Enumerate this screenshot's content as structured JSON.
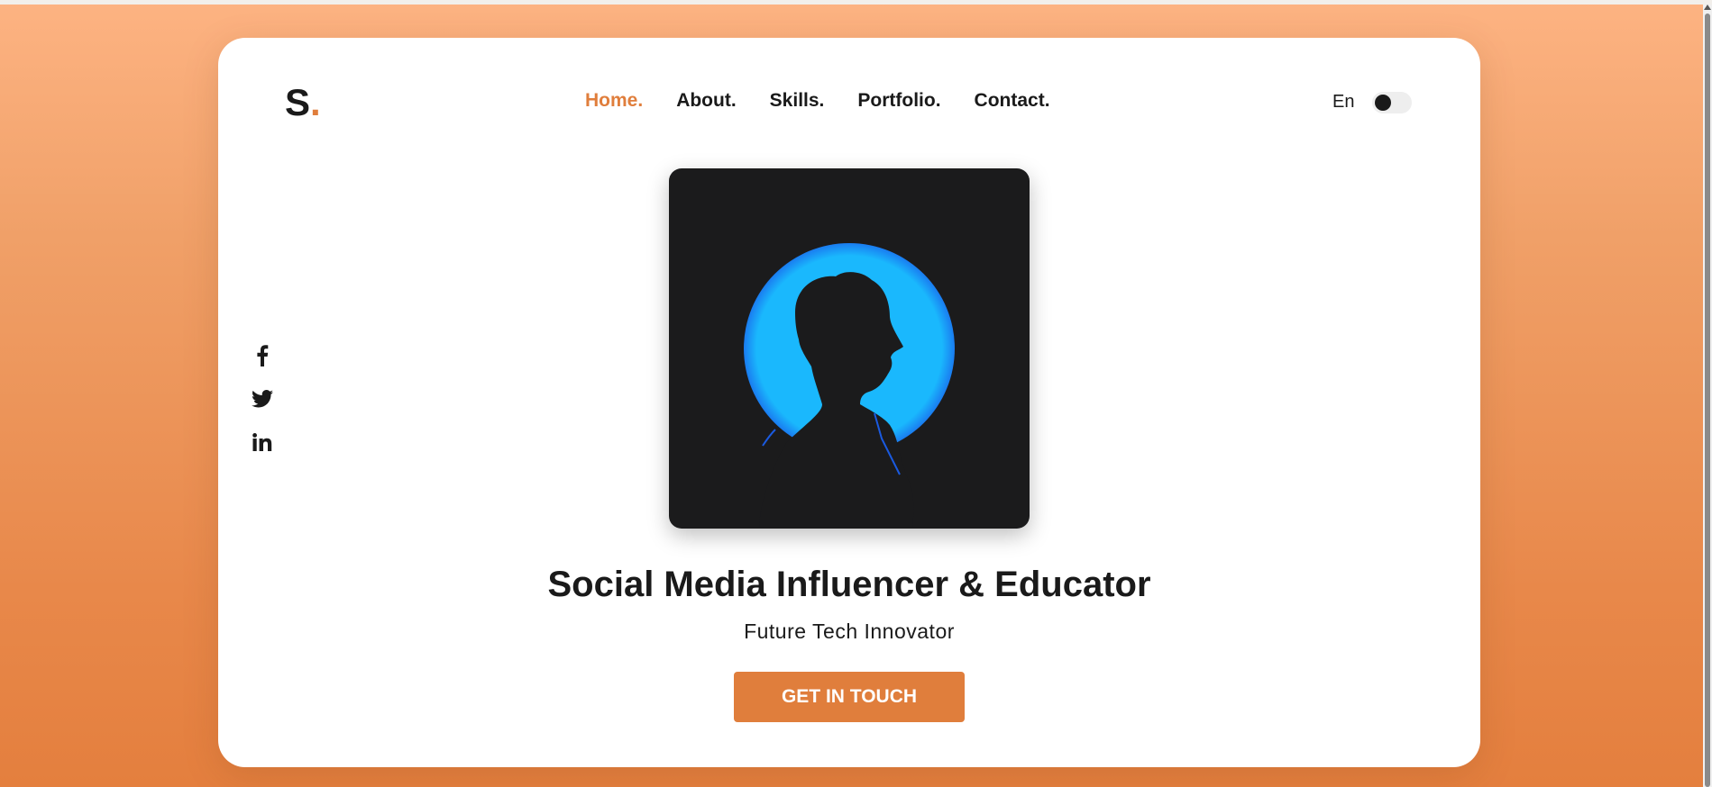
{
  "logo": {
    "letter": "S",
    "dot": "."
  },
  "nav": {
    "items": [
      {
        "label": "Home.",
        "active": true
      },
      {
        "label": "About.",
        "active": false
      },
      {
        "label": "Skills.",
        "active": false
      },
      {
        "label": "Portfolio.",
        "active": false
      },
      {
        "label": "Contact.",
        "active": false
      }
    ]
  },
  "language": {
    "label": "En"
  },
  "theme_toggle": {
    "state": "off"
  },
  "social": [
    "facebook-icon",
    "twitter-icon",
    "linkedin-icon"
  ],
  "hero": {
    "headline": "Social Media Influencer & Educator",
    "subtitle": "Future Tech Innovator",
    "cta_label": "GET IN TOUCH"
  },
  "colors": {
    "accent": "#e07e3c",
    "text": "#1a1a1a",
    "photo_bg": "#1b1b1c",
    "photo_circle": "#1ab8fd"
  }
}
